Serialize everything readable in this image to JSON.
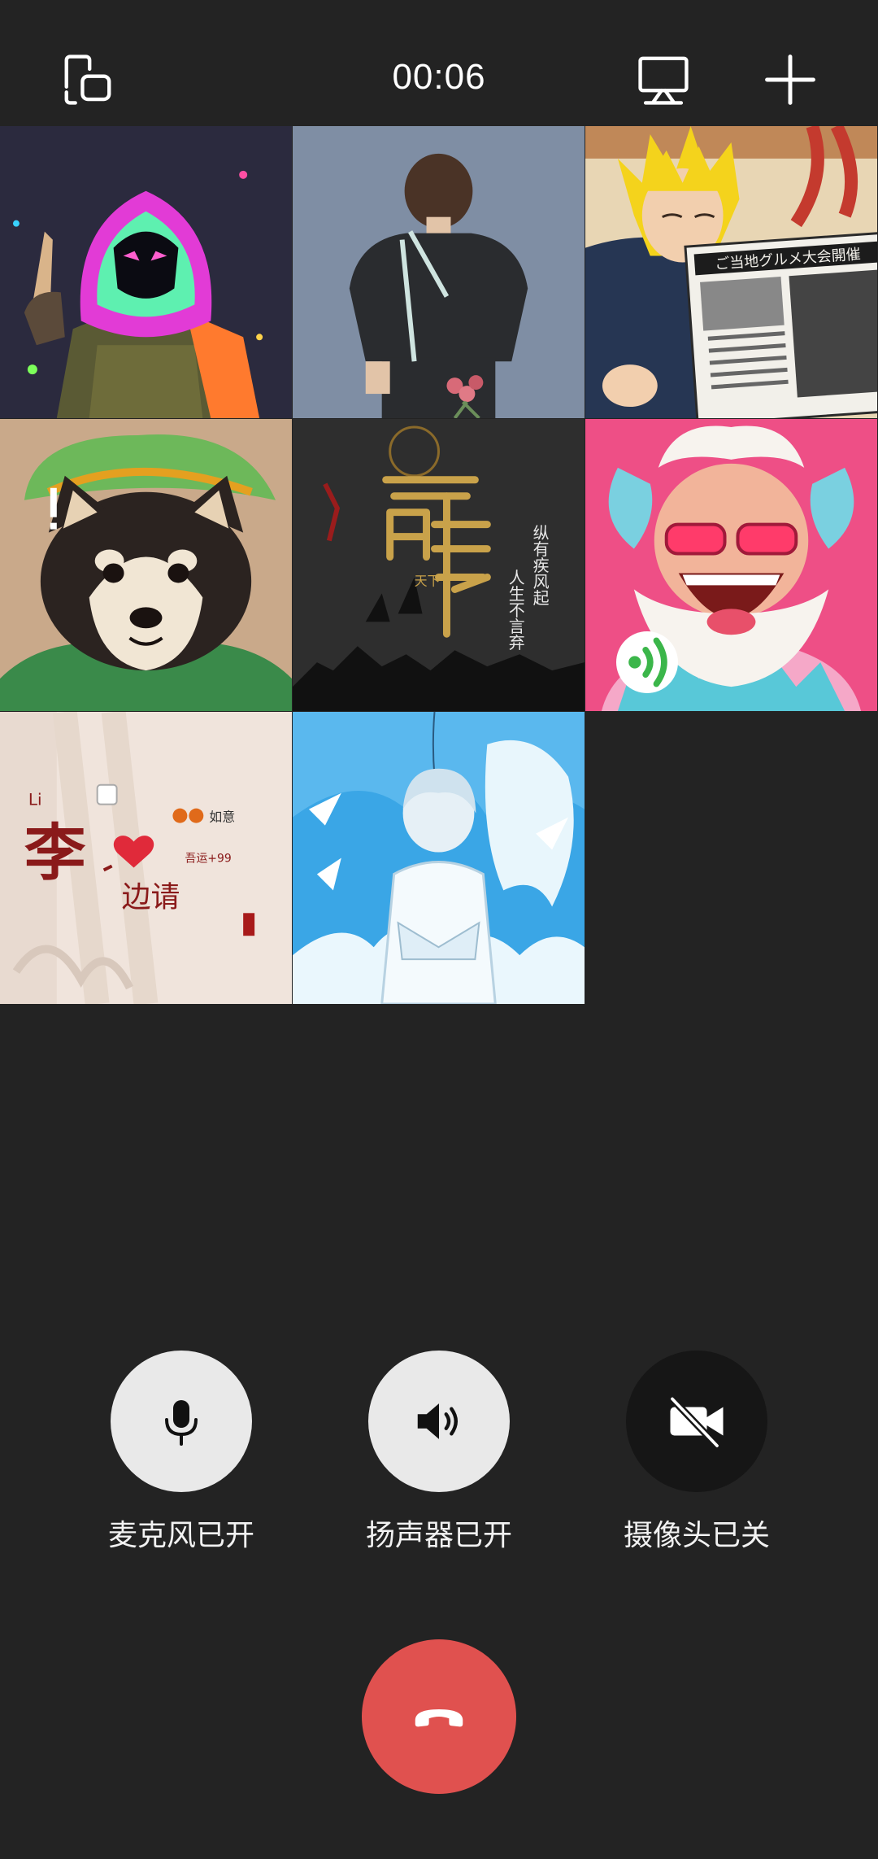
{
  "header": {
    "timer": "00:06"
  },
  "participants": [
    {
      "avatar": "neon-hooded-soldier-avatar"
    },
    {
      "avatar": "boy-back-with-flowers-avatar"
    },
    {
      "avatar": "anime-man-reading-newspaper-avatar",
      "newspaper_text": "ご当地グルメ大会開催"
    },
    {
      "avatar": "shiba-dog-green-hat-avatar"
    },
    {
      "avatar": "golden-calligraphy-avatar",
      "poem_line1": "纵有疾风起",
      "poem_line2": "人生不言弃",
      "speaking": false
    },
    {
      "avatar": "laughing-old-man-horns-avatar",
      "speaking": true
    },
    {
      "avatar": "li-name-card-avatar",
      "surname": "李",
      "given": "边请",
      "roman": "Li",
      "tag": "如意",
      "note": "吾运+99"
    },
    {
      "avatar": "anime-boy-sky-avatar"
    }
  ],
  "controls": {
    "mic_label": "麦克风已开",
    "speaker_label": "扬声器已开",
    "camera_label": "摄像头已关"
  },
  "colors": {
    "background": "#232323",
    "hangup": "#e0514f",
    "button_on": "#e9e9e9",
    "button_off": "#161616",
    "speaking": "#3bb64a"
  }
}
